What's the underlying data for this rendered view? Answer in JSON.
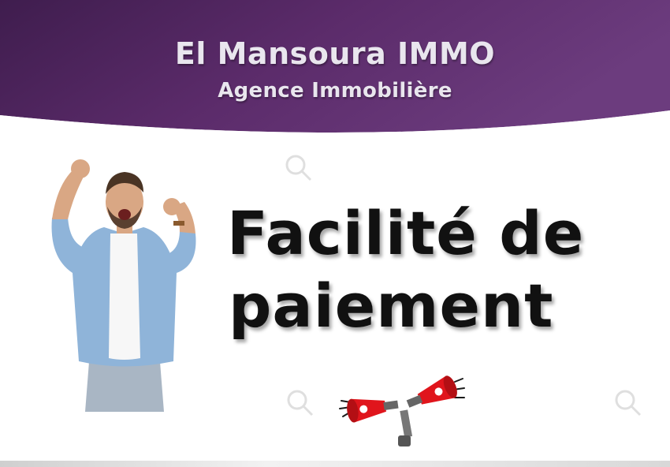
{
  "header": {
    "title": "El Mansoura IMMO",
    "subtitle": "Agence Immobilière",
    "gradient_start": "#4a2358",
    "gradient_end": "#6b3a7a"
  },
  "headline": {
    "line1": "Facilité de",
    "line2": "paiement",
    "color": "#111111"
  },
  "illustration": {
    "icon": "cheering-man-icon",
    "megaphone_icon": "megaphone-icon",
    "megaphone_color": "#e0151c"
  }
}
